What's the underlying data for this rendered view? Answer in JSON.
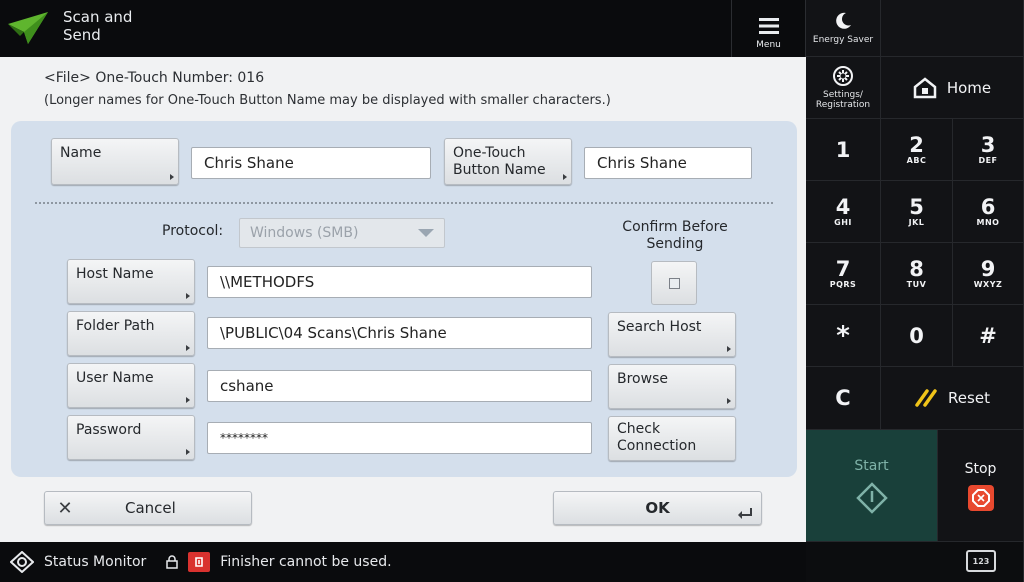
{
  "app": {
    "title": "Scan and Send",
    "icon": "paper-plane-icon"
  },
  "menu": {
    "label": "Menu",
    "icon": "hamburger-icon"
  },
  "right_panel": {
    "energy_saver": "Energy Saver",
    "settings": "Settings/ Registration",
    "home": "Home",
    "keys": [
      {
        "main": "1",
        "sub": ""
      },
      {
        "main": "2",
        "sub": "ABC"
      },
      {
        "main": "3",
        "sub": "DEF"
      },
      {
        "main": "4",
        "sub": "GHI"
      },
      {
        "main": "5",
        "sub": "JKL"
      },
      {
        "main": "6",
        "sub": "MNO"
      },
      {
        "main": "7",
        "sub": "PQRS"
      },
      {
        "main": "8",
        "sub": "TUV"
      },
      {
        "main": "9",
        "sub": "WXYZ"
      },
      {
        "main": "*",
        "sub": ""
      },
      {
        "main": "0",
        "sub": ""
      },
      {
        "main": "#",
        "sub": ""
      }
    ],
    "clear": "C",
    "reset": "Reset",
    "start": "Start",
    "stop": "Stop",
    "colors": {
      "start_bg": "#19403a",
      "stop": "#e8492f",
      "reset_icon": "#f0c419"
    }
  },
  "form": {
    "header_line1": "<File> One-Touch Number: 016",
    "header_line2": "(Longer names for One-Touch Button Name may be displayed with smaller characters.)",
    "name_label": "Name",
    "name_value": "Chris Shane",
    "one_touch_label_1": "One-Touch",
    "one_touch_label_2": "Button Name",
    "one_touch_value": "Chris Shane",
    "protocol_label": "Protocol:",
    "protocol_value": "Windows (SMB)",
    "confirm_label_1": "Confirm Before",
    "confirm_label_2": "Sending",
    "host_label": "Host Name",
    "host_value": "\\\\METHODFS",
    "folder_label": "Folder Path",
    "folder_value": "\\PUBLIC\\04 Scans\\Chris Shane",
    "user_label": "User Name",
    "user_value": "cshane",
    "password_label": "Password",
    "password_value": "********",
    "search_host": "Search Host",
    "browse": "Browse",
    "check_1": "Check",
    "check_2": "Connection",
    "cancel": "Cancel",
    "ok": "OK"
  },
  "status": {
    "monitor": "Status Monitor",
    "message": "Finisher cannot be used.",
    "keyboard": "123"
  }
}
